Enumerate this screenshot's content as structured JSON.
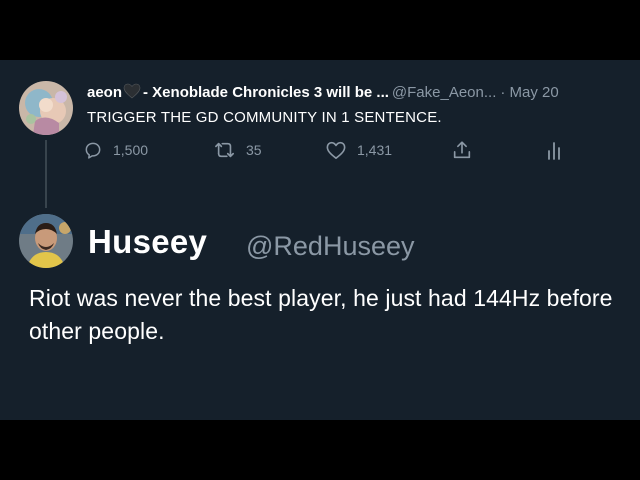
{
  "tweet1": {
    "name": "aeon",
    "name_suffix": "- Xenoblade Chronicles 3 will be ...",
    "handle": "@Fake_Aeon...",
    "date": "· May 20",
    "text": "TRIGGER THE GD COMMUNITY IN 1 SENTENCE.",
    "actions": {
      "reply_count": "1,500",
      "retweet_count": "35",
      "like_count": "1,431"
    }
  },
  "tweet2": {
    "name": "Huseey",
    "handle": "@RedHuseey",
    "text": "Riot was never the best player, he just had 144Hz before other people."
  },
  "icons": {
    "heart_emoji": "black-heart-icon",
    "reply": "reply-icon",
    "retweet": "retweet-icon",
    "like": "like-icon",
    "share": "share-icon",
    "stats": "analytics-icon"
  },
  "colors": {
    "background": "#15202b",
    "letterbox": "#000000",
    "text_primary": "#ffffff",
    "text_secondary": "#8b98a5",
    "thread_line": "#38444d"
  }
}
